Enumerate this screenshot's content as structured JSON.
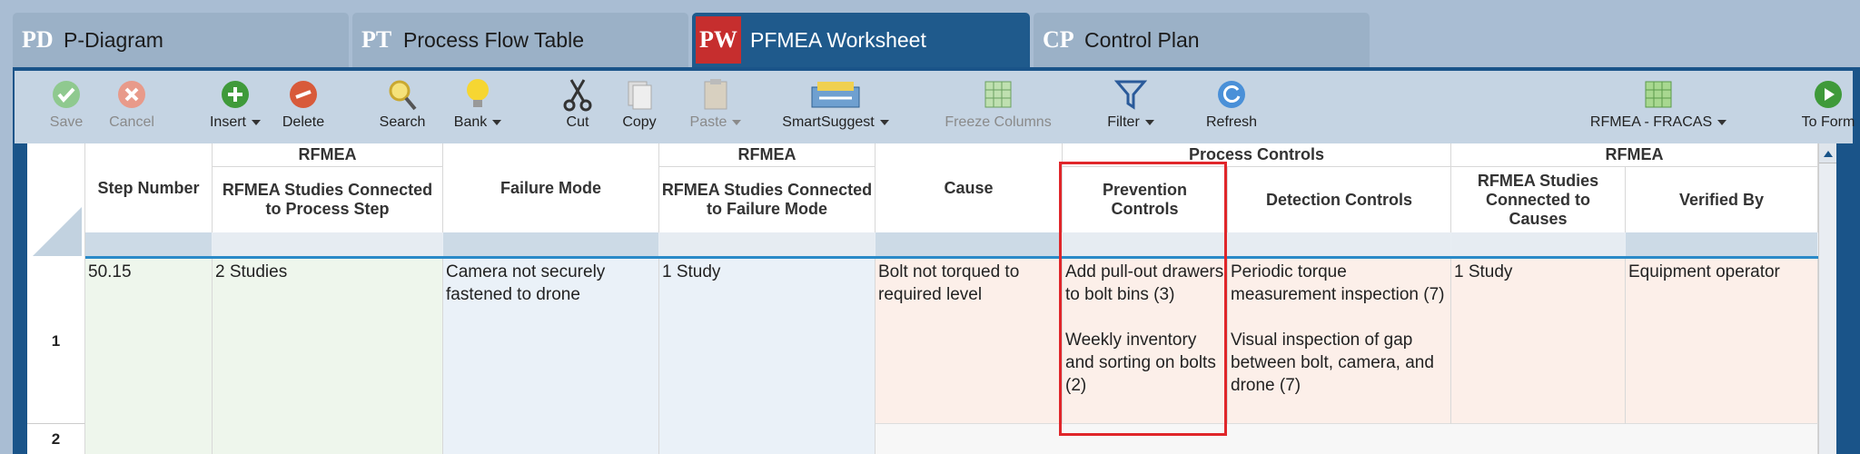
{
  "tabs": [
    {
      "abbr": "PD",
      "label": "P-Diagram"
    },
    {
      "abbr": "PT",
      "label": "Process Flow Table"
    },
    {
      "abbr": "PW",
      "label": "PFMEA Worksheet"
    },
    {
      "abbr": "CP",
      "label": "Control Plan"
    }
  ],
  "toolbar": {
    "save": "Save",
    "cancel": "Cancel",
    "insert": "Insert",
    "delete": "Delete",
    "search": "Search",
    "bank": "Bank",
    "cut": "Cut",
    "copy": "Copy",
    "paste": "Paste",
    "smartsuggest": "SmartSuggest",
    "freeze": "Freeze Columns",
    "filter": "Filter",
    "refresh": "Refresh",
    "fracas": "RFMEA - FRACAS",
    "toform": "To Form"
  },
  "colors": {
    "accent": "#1f5a8c",
    "highlight": "#e0262a"
  },
  "grid": {
    "groups": {
      "rfmea1": "RFMEA",
      "rfmea2": "RFMEA",
      "process_controls": "Process Controls",
      "rfmea3": "RFMEA"
    },
    "headers": {
      "step_number": "Step Number",
      "studies_step": "RFMEA Studies Connected to Process Step",
      "failure_mode": "Failure Mode",
      "studies_fm": "RFMEA Studies Connected to Failure Mode",
      "cause": "Cause",
      "prevention": "Prevention Controls",
      "detection": "Detection Controls",
      "studies_causes": "RFMEA Studies Connected to Causes",
      "verified_by": "Verified By"
    },
    "rows": [
      {
        "num": "1",
        "step_number": "50.15",
        "studies_step": "2 Studies",
        "failure_mode": "Camera not securely fastened to drone",
        "studies_fm": "1 Study",
        "cause": "Bolt not torqued to required level",
        "prevention_1": "Add pull-out drawers to bolt bins (3)",
        "prevention_2": "Weekly inventory and sorting on bolts (2)",
        "detection_1": "Periodic torque measurement inspection (7)",
        "detection_2": "Visual inspection of gap between bolt, camera, and drone (7)",
        "studies_causes": "1 Study",
        "verified_by": "Equipment operator"
      },
      {
        "num": "2"
      }
    ]
  }
}
